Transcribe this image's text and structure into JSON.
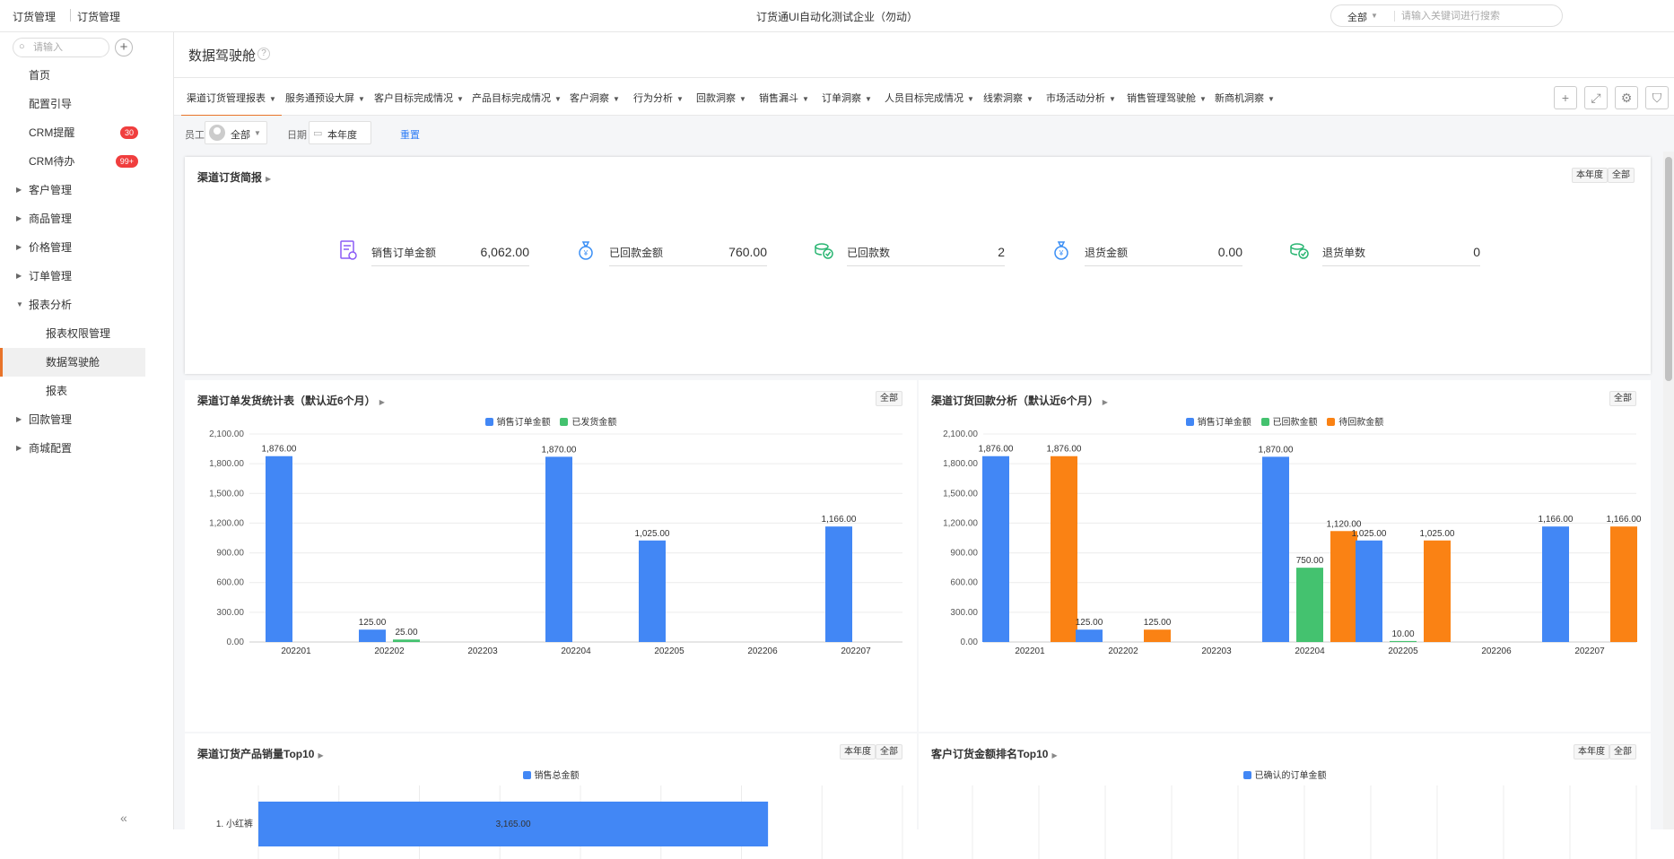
{
  "topbar": {
    "crumb1": "订货管理",
    "crumb2": "订货管理",
    "company": "订货通UI自动化测试企业（勿动）",
    "search_scope": "全部",
    "search_placeholder": "请输入关键词进行搜索"
  },
  "sidebar": {
    "search_placeholder": "请输入",
    "items": [
      {
        "label": "首页",
        "badge": ""
      },
      {
        "label": "配置引导",
        "badge": ""
      },
      {
        "label": "CRM提醒",
        "badge": "30"
      },
      {
        "label": "CRM待办",
        "badge": "99+"
      },
      {
        "label": "客户管理",
        "badge": ""
      },
      {
        "label": "商品管理",
        "badge": ""
      },
      {
        "label": "价格管理",
        "badge": ""
      },
      {
        "label": "订单管理",
        "badge": ""
      },
      {
        "label": "报表分析",
        "badge": ""
      },
      {
        "label": "报表权限管理",
        "badge": ""
      },
      {
        "label": "数据驾驶舱",
        "badge": ""
      },
      {
        "label": "报表",
        "badge": ""
      },
      {
        "label": "回款管理",
        "badge": ""
      },
      {
        "label": "商城配置",
        "badge": ""
      }
    ]
  },
  "page": {
    "title": "数据驾驶舱"
  },
  "tabs": [
    "渠道订货管理报表",
    "服务通预设大屏",
    "客户目标完成情况",
    "产品目标完成情况",
    "客户洞察",
    "行为分析",
    "回款洞察",
    "销售漏斗",
    "订单洞察",
    "人员目标完成情况",
    "线索洞察",
    "市场活动分析",
    "销售管理驾驶舱",
    "新商机洞察"
  ],
  "filters": {
    "employee_label": "员工",
    "employee_value": "全部",
    "date_label": "日期",
    "date_value": "本年度",
    "reset_label": "重置"
  },
  "brief": {
    "title": "渠道订货简报",
    "chip_year": "本年度",
    "chip_all": "全部",
    "kpis": [
      {
        "label": "销售订单金额",
        "value": "6,062.00"
      },
      {
        "label": "已回款金额",
        "value": "760.00"
      },
      {
        "label": "已回款数",
        "value": "2"
      },
      {
        "label": "退货金额",
        "value": "0.00"
      },
      {
        "label": "退货单数",
        "value": "0"
      }
    ]
  },
  "charts": {
    "shipment": {
      "title": "渠道订单发货统计表（默认近6个月）",
      "chip": "全部"
    },
    "payment": {
      "title": "渠道订货回款分析（默认近6个月）",
      "chip": "全部"
    },
    "top_products": {
      "title": "渠道订货产品销量Top10",
      "chip_year": "本年度",
      "chip_all": "全部"
    },
    "top_customers": {
      "title": "客户订货金额排名Top10",
      "chip_year": "本年度",
      "chip_all": "全部"
    }
  },
  "colors": {
    "blue": "#4287f5",
    "green": "#44c26f",
    "orange": "#fa8214",
    "accent": "#e8742a",
    "link": "#2f7df6"
  },
  "chart_data": [
    {
      "type": "bar",
      "title": "渠道订单发货统计表（默认近6个月）",
      "categories": [
        "202201",
        "202202",
        "202203",
        "202204",
        "202205",
        "202206",
        "202207"
      ],
      "ylim": [
        0,
        2100
      ],
      "yticks": [
        "0.00",
        "300.00",
        "600.00",
        "900.00",
        "1,200.00",
        "1,500.00",
        "1,800.00",
        "2,100.00"
      ],
      "series": [
        {
          "name": "销售订单金额",
          "color": "#4287f5",
          "values": [
            1876,
            125,
            0,
            1870,
            1025,
            0,
            1166
          ],
          "labels": [
            "1,876.00",
            "125.00",
            "",
            "1,870.00",
            "1,025.00",
            "",
            "1,166.00"
          ]
        },
        {
          "name": "已发货金额",
          "color": "#44c26f",
          "values": [
            0,
            25,
            0,
            0,
            0,
            0,
            0
          ],
          "labels": [
            "",
            "25.00",
            "",
            "",
            "",
            "",
            ""
          ]
        }
      ]
    },
    {
      "type": "bar",
      "title": "渠道订货回款分析（默认近6个月）",
      "categories": [
        "202201",
        "202202",
        "202203",
        "202204",
        "202205",
        "202206",
        "202207"
      ],
      "ylim": [
        0,
        2100
      ],
      "yticks": [
        "0.00",
        "300.00",
        "600.00",
        "900.00",
        "1,200.00",
        "1,500.00",
        "1,800.00",
        "2,100.00"
      ],
      "series": [
        {
          "name": "销售订单金额",
          "color": "#4287f5",
          "values": [
            1876,
            125,
            0,
            1870,
            1025,
            0,
            1166
          ],
          "labels": [
            "1,876.00",
            "125.00",
            "",
            "1,870.00",
            "1,025.00",
            "",
            "1,166.00"
          ]
        },
        {
          "name": "已回款金额",
          "color": "#44c26f",
          "values": [
            0,
            0,
            0,
            750,
            10,
            0,
            0
          ],
          "labels": [
            "",
            "",
            "",
            "750.00",
            "10.00",
            "",
            ""
          ]
        },
        {
          "name": "待回款金额",
          "color": "#fa8214",
          "values": [
            1876,
            125,
            0,
            1120,
            1025,
            0,
            1166
          ],
          "labels": [
            "1,876.00",
            "125.00",
            "",
            "1,120.00",
            "1,025.00",
            "",
            "1,166.00"
          ]
        }
      ]
    },
    {
      "type": "bar",
      "title": "渠道订货产品销量Top10",
      "orientation": "horizontal",
      "categories": [
        "1. 小红裤"
      ],
      "xlim": [
        0,
        4000
      ],
      "series": [
        {
          "name": "销售总金额",
          "color": "#4287f5",
          "values": [
            3165
          ],
          "labels": [
            "3,165.00"
          ]
        }
      ]
    },
    {
      "type": "bar",
      "title": "客户订货金额排名Top10",
      "orientation": "horizontal",
      "categories": [],
      "series": [
        {
          "name": "已确认的订单金额",
          "color": "#4287f5",
          "values": []
        }
      ]
    }
  ]
}
